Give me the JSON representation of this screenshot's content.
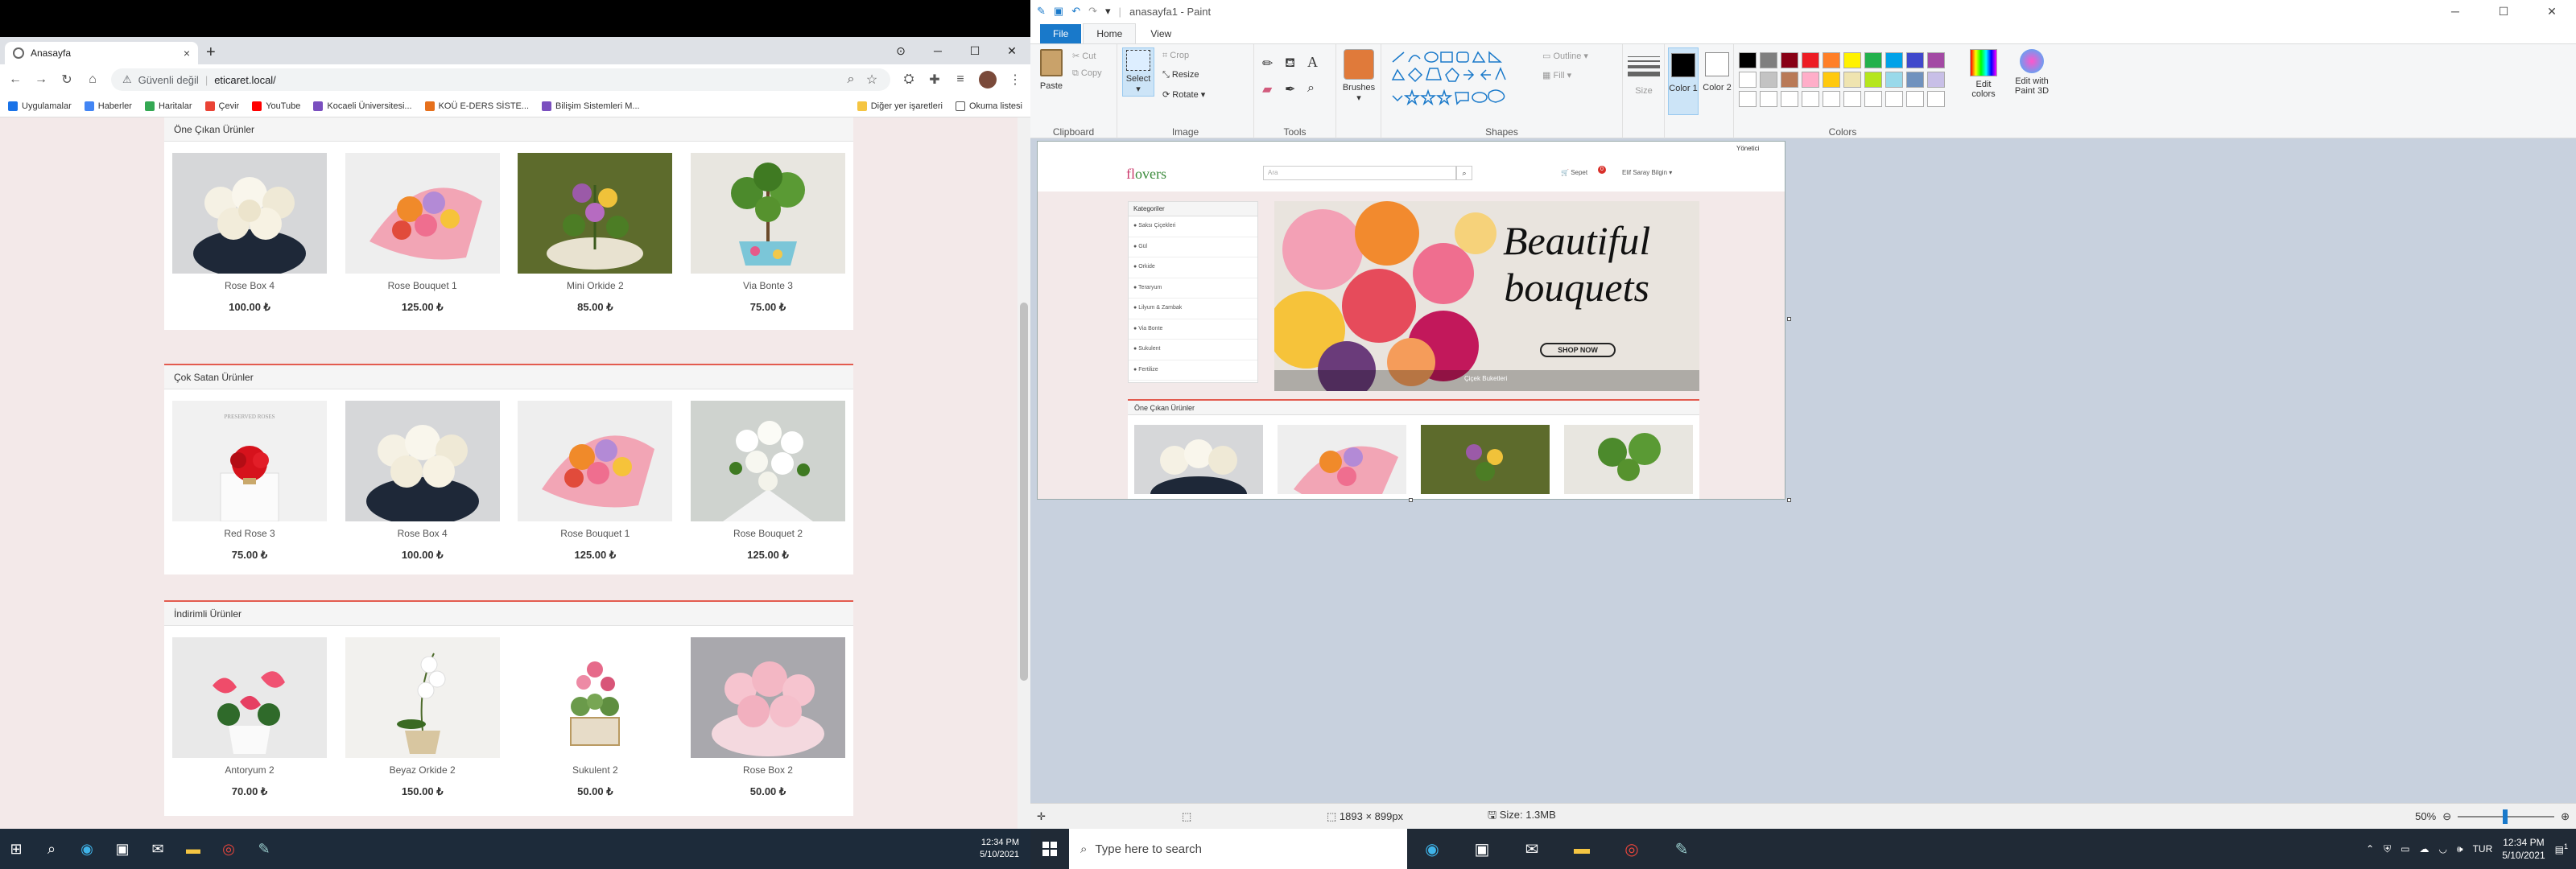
{
  "browser": {
    "tab_title": "Anasayfa",
    "tab_close": "×",
    "new_tab": "+",
    "security_label": "Güvenli değil",
    "url": "eticaret.local/",
    "bookmarks": [
      "Uygulamalar",
      "Haberler",
      "Haritalar",
      "Çevir",
      "YouTube",
      "Kocaeli Üniversitesi...",
      "KOÜ E-DERS SİSTE...",
      "Bilişim Sistemleri M..."
    ],
    "bookmark_colors": [
      "#1a73e8",
      "#4285f4",
      "#34a853",
      "#ea4335",
      "#ff0000",
      "#7a4fbf",
      "#e6701c",
      "#7a4fbf"
    ],
    "bookmarks_right": [
      "Diğer yer işaretleri",
      "Okuma listesi"
    ]
  },
  "store": {
    "sections": [
      {
        "title": "Öne Çıkan Ürünler",
        "products": [
          {
            "name": "Rose Box 4",
            "price": "100.00 ₺"
          },
          {
            "name": "Rose Bouquet 1",
            "price": "125.00 ₺"
          },
          {
            "name": "Mini Orkide 2",
            "price": "85.00 ₺"
          },
          {
            "name": "Via Bonte 3",
            "price": "75.00 ₺"
          }
        ]
      },
      {
        "title": "Çok Satan Ürünler",
        "products": [
          {
            "name": "Red Rose 3",
            "price": "75.00 ₺"
          },
          {
            "name": "Rose Box 4",
            "price": "100.00 ₺"
          },
          {
            "name": "Rose Bouquet 1",
            "price": "125.00 ₺"
          },
          {
            "name": "Rose Bouquet 2",
            "price": "125.00 ₺"
          }
        ]
      },
      {
        "title": "İndirimli Ürünler",
        "products": [
          {
            "name": "Antoryum 2",
            "price": "70.00 ₺"
          },
          {
            "name": "Beyaz Orkide 2",
            "price": "150.00 ₺"
          },
          {
            "name": "Sukulent 2",
            "price": "50.00 ₺"
          },
          {
            "name": "Rose Box 2",
            "price": "50.00 ₺"
          }
        ]
      }
    ],
    "red_rose_box_label": "PRESERVED ROSES"
  },
  "taskbar_left": {
    "time": "12:34 PM",
    "date": "5/10/2021"
  },
  "paint": {
    "title": "anasayfa1 - Paint",
    "tabs": [
      "File",
      "Home",
      "View"
    ],
    "clipboard": {
      "paste": "Paste",
      "cut": "Cut",
      "copy": "Copy",
      "label": "Clipboard"
    },
    "image": {
      "select": "Select",
      "crop": "Crop",
      "resize": "Resize",
      "rotate": "Rotate",
      "label": "Image"
    },
    "tools_label": "Tools",
    "brushes": "Brushes",
    "shapes": {
      "outline": "Outline",
      "fill": "Fill",
      "label": "Shapes"
    },
    "size": "Size",
    "color1": "Color 1",
    "color2": "Color 2",
    "colors_label": "Colors",
    "edit_colors": "Edit colors",
    "edit_3d": "Edit with Paint 3D",
    "palette": [
      "#000000",
      "#7f7f7f",
      "#880015",
      "#ed1c24",
      "#ff7f27",
      "#fff200",
      "#22b14c",
      "#00a2e8",
      "#3f48cc",
      "#a349a4",
      "#ffffff",
      "#c3c3c3",
      "#b97a57",
      "#ffaec9",
      "#ffc90e",
      "#efe4b0",
      "#b5e61d",
      "#99d9ea",
      "#7092be",
      "#c8bfe7",
      "#ffffff",
      "#ffffff",
      "#ffffff",
      "#ffffff",
      "#ffffff",
      "#ffffff",
      "#ffffff",
      "#ffffff",
      "#ffffff",
      "#ffffff"
    ],
    "status": {
      "dimensions": "1893 × 899px",
      "size": "Size: 1.3MB",
      "zoom": "50%"
    }
  },
  "mini_site": {
    "logo_a": "fl",
    "logo_b": "overs",
    "search_placeholder": "Ara",
    "cart": "Sepet",
    "cart_count": "0",
    "user": "Elif Saray Bilgin",
    "admin": "Yönetici",
    "categories_title": "Kategoriler",
    "categories": [
      "Saksı Çiçekleri",
      "Gül",
      "Orkide",
      "Teraryum",
      "Lilyum & Zambak",
      "Via Bonte",
      "Sukulent",
      "Fertilize"
    ],
    "banner_line1": "Beautiful",
    "banner_line2": "bouquets",
    "banner_button": "SHOP NOW",
    "banner_caption": "Çiçek Buketleri",
    "featured_title": "Öne Çıkan Ürünler"
  },
  "taskbar_right": {
    "search_placeholder": "Type here to search",
    "lang": "TUR",
    "time": "12:34 PM",
    "date": "5/10/2021",
    "notifications": "1"
  }
}
